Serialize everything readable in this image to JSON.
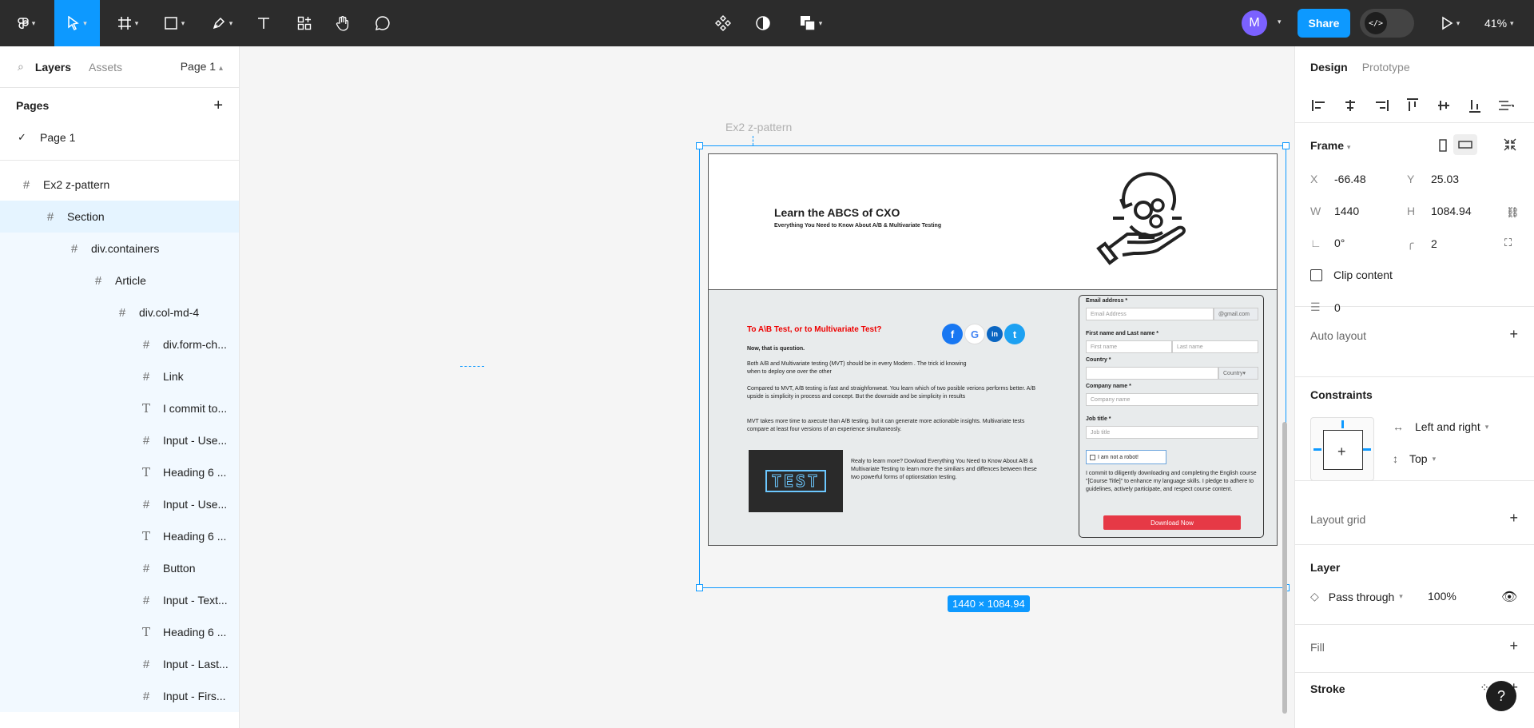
{
  "toolbar": {
    "share_label": "Share",
    "avatar_initial": "M",
    "zoom": "41%",
    "accent": "#0d99ff"
  },
  "left_panel": {
    "tabs": [
      "Layers",
      "Assets"
    ],
    "page_selector": "Page 1",
    "pages_header": "Pages",
    "pages": [
      "Page 1"
    ],
    "layers": [
      {
        "label": "Ex2 z-pattern",
        "icon": "frame-icon"
      },
      {
        "label": "Section",
        "icon": "frame-icon"
      },
      {
        "label": "div.containers",
        "icon": "frame-icon"
      },
      {
        "label": "Article",
        "icon": "frame-icon"
      },
      {
        "label": "div.col-md-4",
        "icon": "frame-icon"
      },
      {
        "label": "div.form-ch...",
        "icon": "frame-icon"
      },
      {
        "label": "Link",
        "icon": "frame-icon"
      },
      {
        "label": "I commit to...",
        "icon": "text-icon"
      },
      {
        "label": "Input - Use...",
        "icon": "frame-icon"
      },
      {
        "label": "Heading 6 ...",
        "icon": "text-icon"
      },
      {
        "label": "Input - Use...",
        "icon": "frame-icon"
      },
      {
        "label": "Heading 6 ...",
        "icon": "text-icon"
      },
      {
        "label": "Button",
        "icon": "frame-icon"
      },
      {
        "label": "Input - Text...",
        "icon": "frame-icon"
      },
      {
        "label": "Heading 6 ...",
        "icon": "text-icon"
      },
      {
        "label": "Input - Last...",
        "icon": "frame-icon"
      },
      {
        "label": "Input - Firs...",
        "icon": "frame-icon"
      }
    ]
  },
  "canvas": {
    "frame_label": "Ex2 z-pattern",
    "size_badge": "1440 × 1084.94",
    "design": {
      "hero_title": "Learn the ABCS of CXO",
      "hero_subtitle": "Everything You Need to Know About A/B & Multivariate Testing",
      "section_title": "To A\\B Test, or to Multivariate Test?",
      "section_sub": "Now, that is question.",
      "para1": "Both A/B and Multivariate testing (MVT) should be in every Modern . The trick id knowing when to deploy one over the other",
      "para2": "Compared to MVT, A/B testing is fast and straighfonweat. You learn which of two posible verions performs better. A/B upside is simplicity in process and concept. But the downside and be simplicity in results",
      "para3": "MVT takes more time to axecute than A/B testing. but it can generate more actionable insights. Multivariate tests compare at least four versions of an experience simultaneosly.",
      "para4": "Realy to learn more? Dowload Everything You Need to Know About A/B & Multivariate Testing to learn more the similiars and diffences between these two powerful forms of optionstation testing.",
      "test_word": "TEST",
      "social": [
        "f",
        "G",
        "in",
        "t"
      ],
      "form": {
        "email_label": "Email address *",
        "email_placeholder": "Email Address",
        "email_suffix": "@gmail.com",
        "name_label": "First name and Last name *",
        "first_placeholder": "First name",
        "last_placeholder": "Last name",
        "country_label": "Country *",
        "country_select": "Country",
        "company_label": "Company name *",
        "company_placeholder": "Company name",
        "job_label": "Job title *",
        "job_placeholder": "Job title",
        "robot": "I am not a robot!",
        "commit": "I commit to diligently downloading and completing the English course \"[Course Title]\" to enhance my language skills. I pledge to adhere to guidelines, actively participate, and respect course content.",
        "button": "Download Now"
      }
    }
  },
  "right_panel": {
    "tabs": [
      "Design",
      "Prototype"
    ],
    "frame_title": "Frame",
    "x": "-66.48",
    "y": "25.03",
    "w": "1440",
    "h": "1084.94",
    "rotation": "0°",
    "radius": "2",
    "clip_content": "Clip content",
    "spacing": "0",
    "auto_layout": "Auto layout",
    "constraints": "Constraints",
    "constraint_h": "Left and right",
    "constraint_v": "Top",
    "layout_grid": "Layout grid",
    "layer": "Layer",
    "blend": "Pass through",
    "opacity": "100%",
    "fill": "Fill",
    "stroke": "Stroke"
  }
}
